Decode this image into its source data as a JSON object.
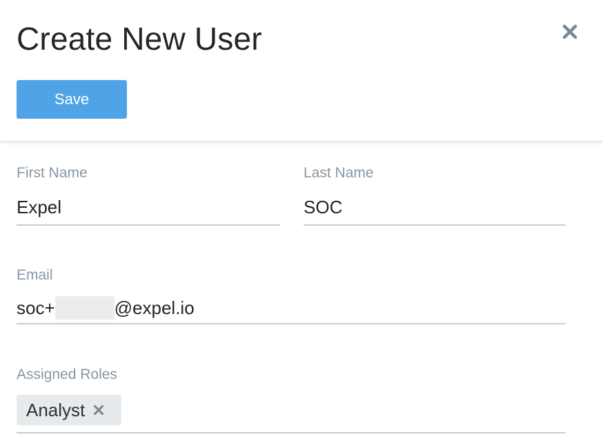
{
  "dialog": {
    "title": "Create New User",
    "close_icon": "close-icon",
    "save_label": "Save"
  },
  "form": {
    "first_name": {
      "label": "First Name",
      "value": "Expel"
    },
    "last_name": {
      "label": "Last Name",
      "value": "SOC"
    },
    "email": {
      "label": "Email",
      "value_prefix": "soc+",
      "value_suffix": "@expel.io"
    },
    "assigned_roles": {
      "label": "Assigned Roles",
      "roles": [
        {
          "label": "Analyst",
          "remove_icon": "close-icon"
        }
      ]
    }
  },
  "colors": {
    "primary_button": "#4fa3e6",
    "label_text": "#8996a3",
    "underline": "#c3ccd4",
    "chip_background": "#e7eaed",
    "icon_gray": "#7d8995"
  }
}
